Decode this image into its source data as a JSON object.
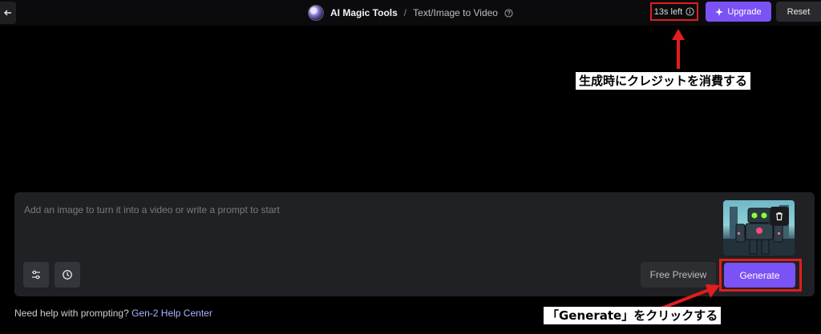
{
  "header": {
    "back_icon": "arrow-left-icon",
    "brand": "AI Magic Tools",
    "separator": "/",
    "section": "Text/Image to Video",
    "help_icon": "question-circle-icon",
    "time_left": "13s left",
    "time_icon": "info-icon",
    "upgrade_label": "Upgrade",
    "upgrade_icon": "sparkle-icon",
    "reset_label": "Reset"
  },
  "annotations": {
    "credit_note": "生成時にクレジットを消費する",
    "generate_note": "「Generate」をクリックする",
    "highlight_color": "#e11d1d"
  },
  "composer": {
    "prompt_placeholder": "Add an image to turn it into a video or write a prompt to start",
    "prompt_value": "",
    "thumbnail_alt": "robot image",
    "delete_icon": "trash-icon",
    "settings_icon": "sliders-icon",
    "history_icon": "clock-icon",
    "free_preview_label": "Free Preview",
    "generate_label": "Generate"
  },
  "footer": {
    "help_text": "Need help with prompting?",
    "help_link": "Gen-2 Help Center"
  },
  "colors": {
    "accent": "#7b52f5",
    "background": "#000000",
    "panel": "#202124"
  }
}
